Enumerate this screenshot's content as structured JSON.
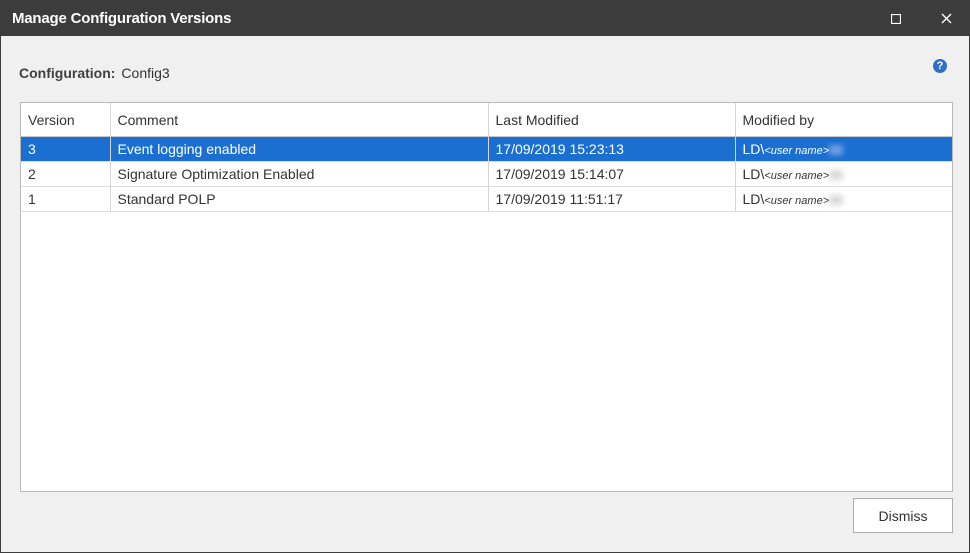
{
  "window": {
    "title": "Manage Configuration Versions",
    "maximize_icon": "maximize-icon",
    "close_icon": "close-icon"
  },
  "config": {
    "label": "Configuration:",
    "value": "Config3"
  },
  "help": {
    "icon": "help-icon",
    "glyph": "?"
  },
  "table": {
    "columns": [
      "Version",
      "Comment",
      "Last Modified",
      "Modified by"
    ],
    "rows": [
      {
        "version": "3",
        "comment": "Event logging enabled",
        "last_modified": "17/09/2019 15:23:13",
        "modified_by_prefix": "LD\\",
        "modified_by_user": "<user name>",
        "selected": true
      },
      {
        "version": "2",
        "comment": "Signature Optimization Enabled",
        "last_modified": "17/09/2019 15:14:07",
        "modified_by_prefix": "LD\\",
        "modified_by_user": "<user name>",
        "selected": false
      },
      {
        "version": "1",
        "comment": "Standard POLP",
        "last_modified": "17/09/2019 11:51:17",
        "modified_by_prefix": "LD\\",
        "modified_by_user": "<user name>",
        "selected": false
      }
    ]
  },
  "buttons": {
    "dismiss": "Dismiss"
  },
  "colors": {
    "titlebar": "#3c3c3c",
    "selection": "#1a6fd0",
    "help_icon": "#2f6fc6"
  }
}
